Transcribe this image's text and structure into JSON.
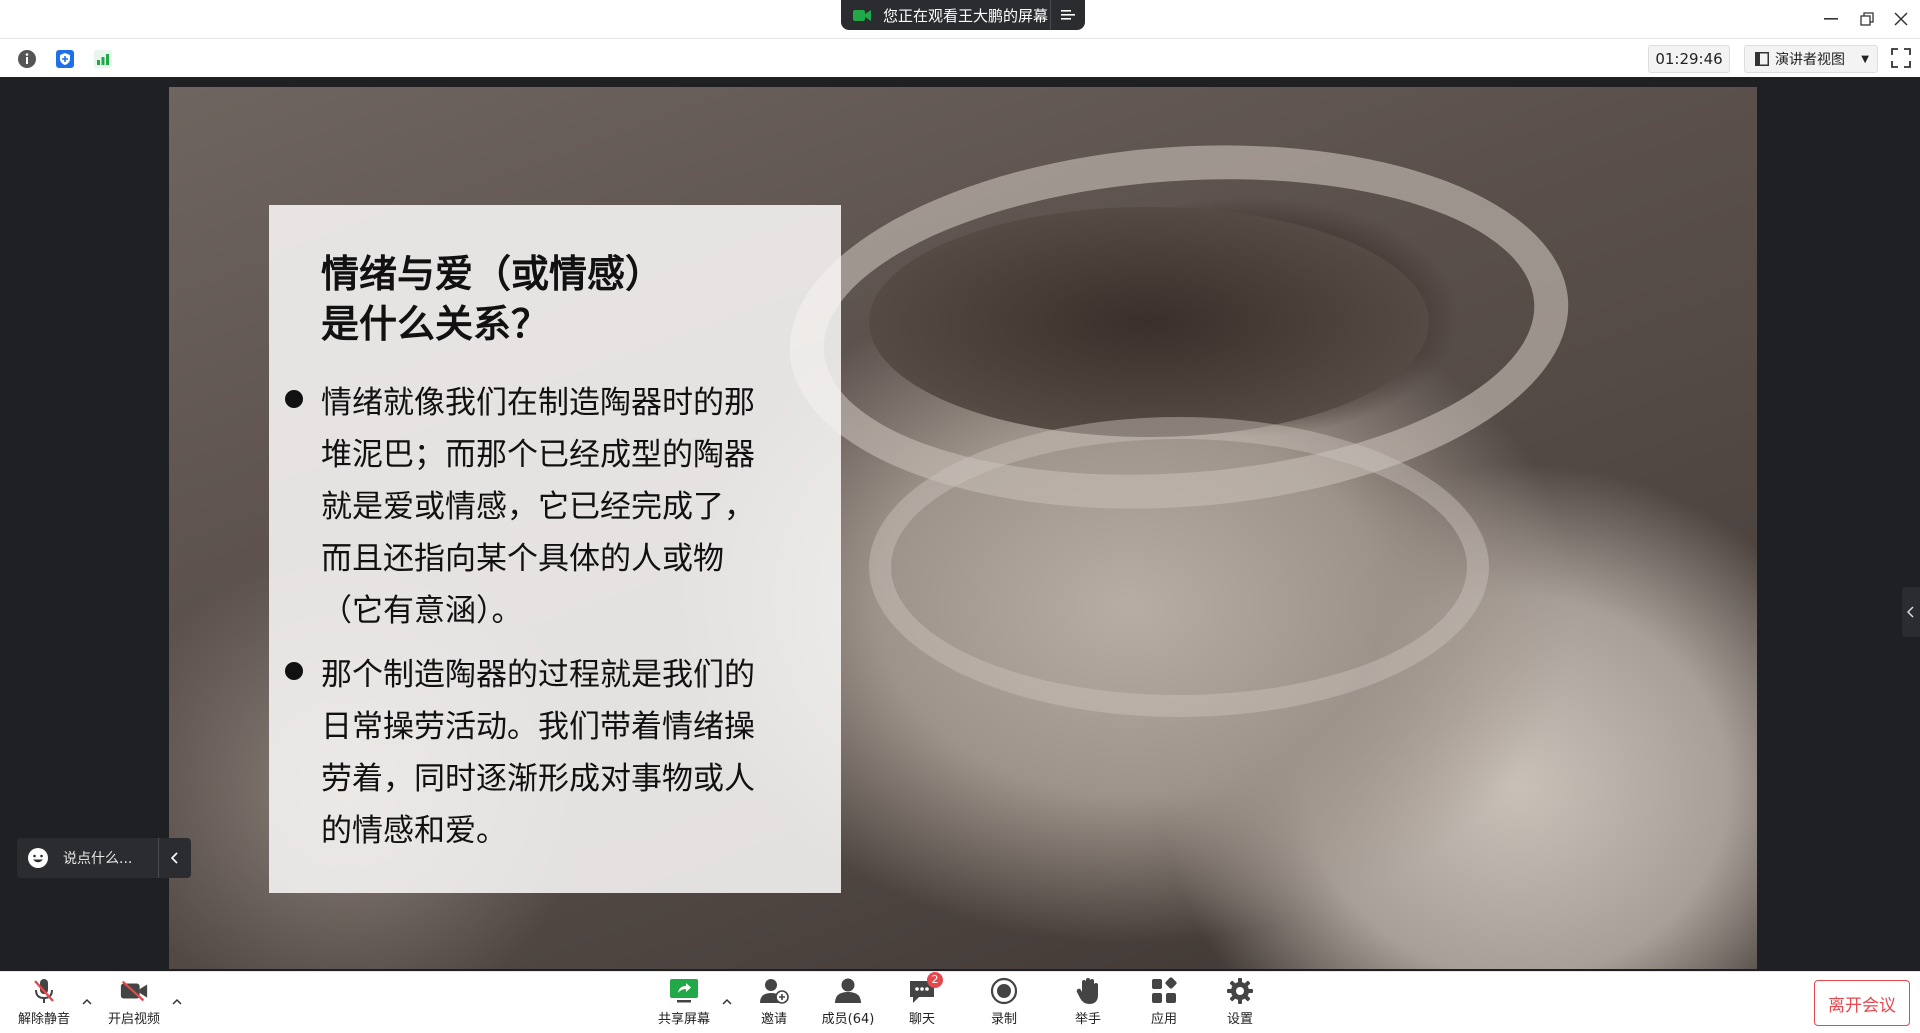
{
  "window": {
    "share_banner": "您正在观看王大鹏的屏幕"
  },
  "toolbar": {
    "timer": "01:29:46",
    "view_mode": "演讲者视图"
  },
  "slide": {
    "title_lines": [
      "情绪与爱（或情感）",
      "是什么关系？"
    ],
    "bullets": [
      {
        "lines": [
          "情绪就像我们在制造陶器时的那",
          "堆泥巴；而那个已经成型的陶器",
          "就是爱或情感，它已经完成了，",
          "而且还指向某个具体的人或物",
          "（它有意涵）。"
        ]
      },
      {
        "lines": [
          "那个制造陶器的过程就是我们的",
          "日常操劳活动。我们带着情绪操",
          "劳着，同时逐渐形成对事物或人",
          "的情感和爱。"
        ]
      }
    ]
  },
  "quick_chat": {
    "placeholder": "说点什么..."
  },
  "controls": {
    "unmute": "解除静音",
    "start_video": "开启视频",
    "share_screen": "共享屏幕",
    "invite": "邀请",
    "members": "成员(64)",
    "chat": "聊天",
    "chat_badge": "2",
    "record": "录制",
    "raise_hand": "举手",
    "apps": "应用",
    "settings": "设置",
    "leave": "离开会议"
  },
  "colors": {
    "accent_green": "#21a848",
    "danger_red": "#e5484d",
    "info_blue": "#1f6feb"
  }
}
